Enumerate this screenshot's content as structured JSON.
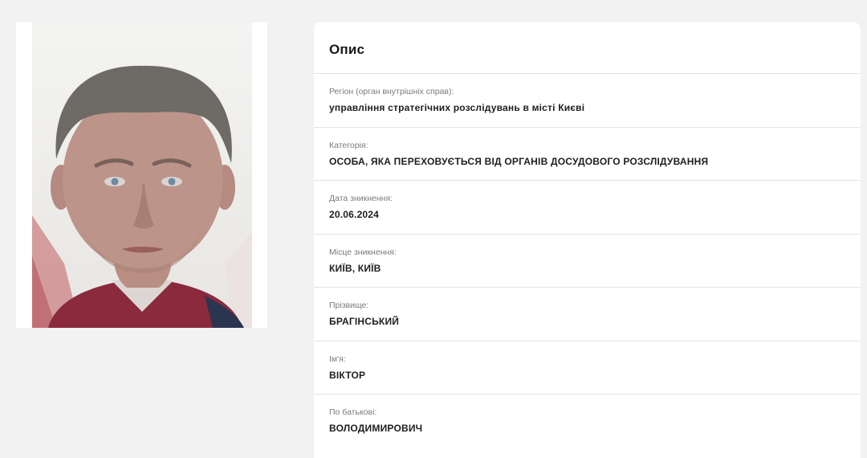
{
  "photo": {
    "icon": "person-photo"
  },
  "card": {
    "title": "Опис",
    "fields": [
      {
        "label": "Регіон (орган внутрішніх справ):",
        "value": "управління стратегічних розслідувань в місті Києві"
      },
      {
        "label": "Категорія:",
        "value": "ОСОБА, ЯКА ПЕРЕХОВУЄТЬСЯ ВІД ОРГАНІВ ДОСУДОВОГО РОЗСЛІДУВАННЯ"
      },
      {
        "label": "Дата зникнення:",
        "value": "20.06.2024"
      },
      {
        "label": "Місце зникнення:",
        "value": "КИЇВ, КИЇВ"
      },
      {
        "label": "Прізвище:",
        "value": "БРАГІНСЬКИЙ"
      },
      {
        "label": "Ім'я:",
        "value": "ВІКТОР"
      },
      {
        "label": "По батькові:",
        "value": "ВОЛОДИМИРОВИЧ"
      }
    ]
  },
  "colors": {
    "background": "#f2f2f2",
    "card": "#ffffff",
    "divider": "#e3e3e3",
    "label": "#7a7a7a",
    "value": "#1e1e1e"
  }
}
